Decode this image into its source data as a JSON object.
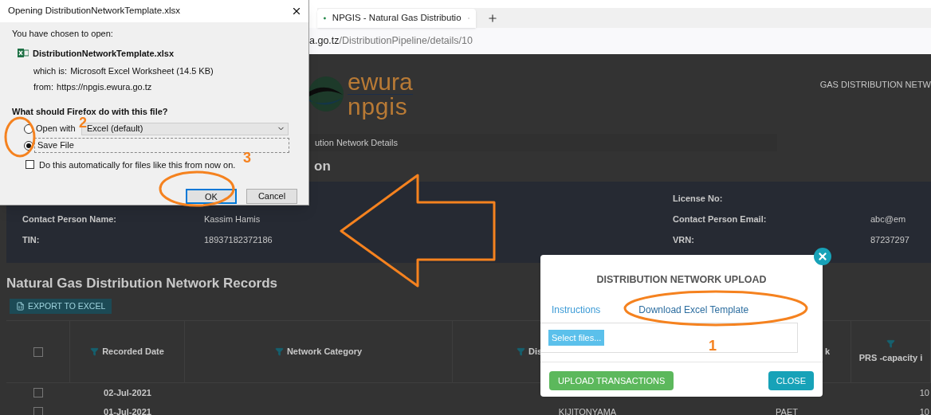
{
  "browser": {
    "tab_title": "NPGIS - Natural Gas Distributio",
    "url_host": "a.go.tz",
    "url_path": "/DistributionPipeline/details/10"
  },
  "header": {
    "logo_top": "ewura",
    "logo_bottom": "npgis",
    "nav": "GAS DISTRIBUTION NETW"
  },
  "breadcrumb": "ution Network Details",
  "section_title": "on",
  "info_rows": [
    {
      "right_label": "License No:"
    },
    {
      "left_label": "Contact Person Name:",
      "left_value": "Kassim Hamis",
      "right_label": "Contact Person Email:",
      "right_value": "abc@em"
    },
    {
      "left_label": "TIN:",
      "left_value": "18937182372186",
      "right_label": "VRN:",
      "right_value": "87237297"
    }
  ],
  "records_title": "Natural Gas Distribution Network Records",
  "export_button": "EXPORT TO EXCEL",
  "table": {
    "select_all": {
      "checked": false
    },
    "columns": [
      "Recorded Date",
      "Network Category",
      "Dis",
      "k",
      "PRS -capacity i"
    ],
    "rows": [
      {
        "checked": false,
        "cells": [
          "02-Jul-2021",
          "",
          "",
          "",
          "10"
        ]
      },
      {
        "checked": false,
        "cells": [
          "01-Jul-2021",
          "",
          "KIJITONYAMA",
          "PAET",
          "10"
        ]
      }
    ]
  },
  "upload_modal": {
    "title": "DISTRIBUTION NETWORK UPLOAD",
    "links": [
      "Instructions",
      "Download Excel Template"
    ],
    "select_button": "Select files...",
    "upload_button": "UPLOAD TRANSACTIONS",
    "close_button": "CLOSE"
  },
  "firefox_dialog": {
    "title": "Opening DistributionNetworkTemplate.xlsx",
    "intro": "You have chosen to open:",
    "file_name": "DistributionNetworkTemplate.xlsx",
    "type_label": "which is:",
    "type_value": "Microsoft Excel Worksheet (14.5 KB)",
    "from_label": "from:",
    "from_value": "https://npgis.ewura.go.tz",
    "question": "What should Firefox do with this file?",
    "options": [
      {
        "label": "Open with",
        "selected": false
      },
      {
        "label": "Save File",
        "selected": true
      }
    ],
    "open_with_app": "Excel (default)",
    "auto_checkbox": {
      "label": "Do this automatically for files like this from now on.",
      "checked": false
    },
    "buttons": [
      {
        "label": "OK",
        "default": true
      },
      {
        "label": "Cancel",
        "default": false
      }
    ]
  },
  "annotations": [
    "1",
    "2",
    "3"
  ]
}
